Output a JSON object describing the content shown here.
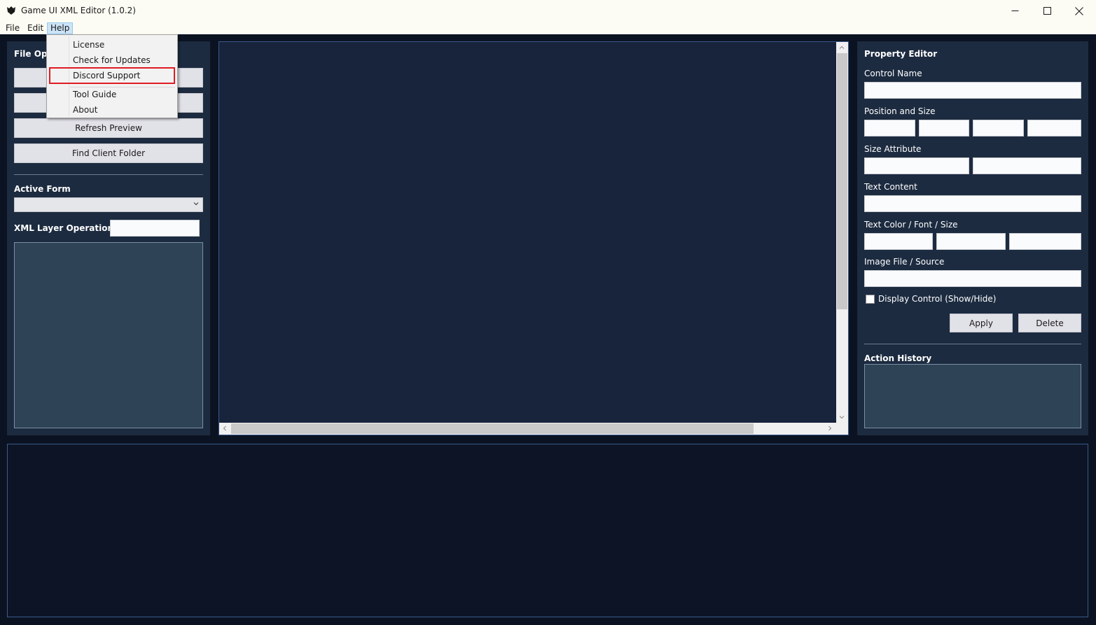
{
  "window": {
    "title": "Game UI XML Editor (1.0.2)"
  },
  "menubar": {
    "file": "File",
    "edit": "Edit",
    "help": "Help"
  },
  "help_menu": {
    "items": [
      "License",
      "Check for Updates",
      "Discord Support",
      "Tool Guide",
      "About"
    ]
  },
  "left_panel": {
    "file_ops_title": "File Ope",
    "refresh_preview": "Refresh Preview",
    "find_client_folder": "Find Client Folder",
    "active_form_label": "Active Form",
    "xml_layer_ops_label": "XML Layer Operations"
  },
  "property_editor": {
    "title": "Property Editor",
    "control_name": "Control Name",
    "position_size": "Position and Size",
    "size_attribute": "Size Attribute",
    "text_content": "Text Content",
    "text_color_font_size": "Text Color / Font / Size",
    "image_file_source": "Image File / Source",
    "display_control": "Display Control (Show/Hide)",
    "apply": "Apply",
    "delete": "Delete",
    "action_history": "Action History"
  },
  "icons": {
    "app": "shield-icon",
    "minimize": "minimize-icon",
    "maximize": "maximize-icon",
    "close": "close-icon"
  }
}
